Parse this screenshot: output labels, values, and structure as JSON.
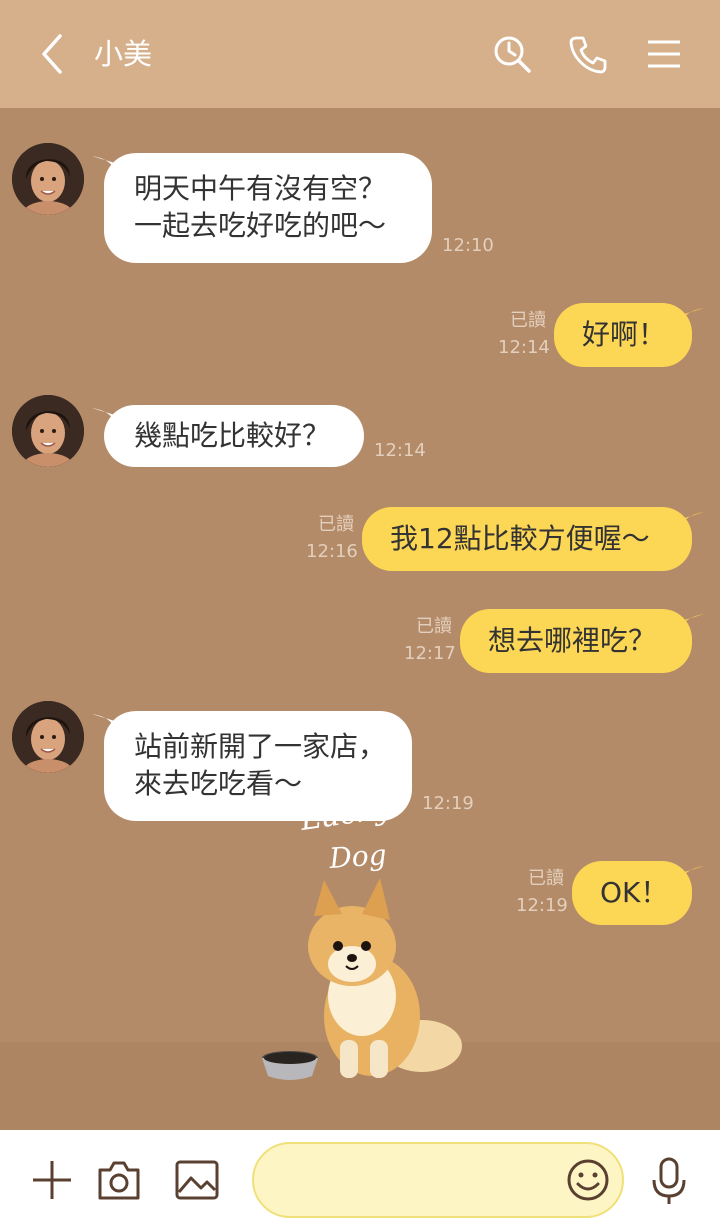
{
  "header": {
    "title": "小美",
    "icons": [
      "back-icon",
      "search-clock-icon",
      "phone-icon",
      "menu-icon"
    ]
  },
  "messages": [
    {
      "side": "in",
      "lines": [
        "明天中午有沒有空？",
        "一起去吃好吃的吧～"
      ],
      "time": "12:10"
    },
    {
      "side": "out",
      "text": "好啊！",
      "read": "已讀",
      "time": "12:14"
    },
    {
      "side": "in",
      "lines": [
        "幾點吃比較好？"
      ],
      "time": "12:14"
    },
    {
      "side": "out",
      "text": "我12點比較方便喔～",
      "read": "已讀",
      "time": "12:16"
    },
    {
      "side": "out",
      "text": "想去哪裡吃？",
      "read": "已讀",
      "time": "12:17"
    },
    {
      "side": "in",
      "lines": [
        "站前新開了一家店，",
        "來去吃吃看～"
      ],
      "time": "12:19"
    },
    {
      "side": "out",
      "text": "OK！",
      "read": "已讀",
      "time": "12:19"
    }
  ],
  "sticker": {
    "text_line1": "Lucky",
    "text_line2": "Dog",
    "icon": "pomeranian-dog-sticker"
  },
  "input": {
    "value": "",
    "placeholder": ""
  },
  "toolbar_icons": [
    "plus-icon",
    "camera-icon",
    "image-icon",
    "smiley-icon",
    "microphone-icon"
  ],
  "colors": {
    "header_bg": "#d6af8b",
    "chat_bg": "#b48b68",
    "incoming_bubble": "#ffffff",
    "outgoing_bubble": "#fcd655",
    "input_bg": "#fdf5c3",
    "icon_brown": "#5a4030"
  }
}
